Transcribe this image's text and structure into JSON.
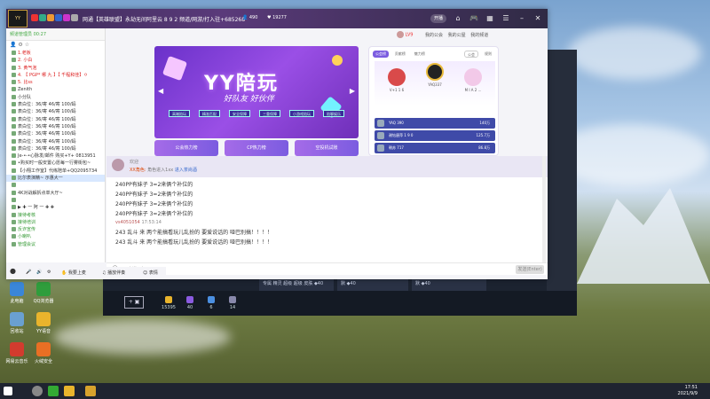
{
  "window": {
    "channel_logo": "YY",
    "title": "网通【英雄联盟】永劫无间阿里云 8 9 2 频道/网游/打入驻+685268",
    "member_count": "490",
    "fans": "19277",
    "open_btn": "开播",
    "level": "LV9",
    "right_links": [
      "我的公会",
      "我的公屋",
      "我的频道"
    ]
  },
  "sidebar": {
    "header": "频道管理员 00:27",
    "members": [
      {
        "text": "1.老板",
        "style": "red"
      },
      {
        "text": "2. 小白",
        "style": "red"
      },
      {
        "text": "3. 黄气泡",
        "style": "red"
      },
      {
        "text": "4. 【 PGP* 哪 九 】【 千程和佳】ㅇ",
        "style": "red"
      },
      {
        "text": "5. 比ss",
        "style": "red"
      },
      {
        "text": "Zenith",
        "style": "normal"
      },
      {
        "text": "小分队",
        "style": "normal"
      },
      {
        "text": "表白位：36/寄 46/寄 100/蚂",
        "style": "normal"
      },
      {
        "text": "表白位：36/寄 46/寄 100/蚂",
        "style": "normal"
      },
      {
        "text": "表白位：36/寄 46/寄 100/蚂",
        "style": "normal"
      },
      {
        "text": "表白位：36/寄 46/寄 100/蚂",
        "style": "normal"
      },
      {
        "text": "表白位：36/寄 46/寄 100/蚂",
        "style": "normal"
      },
      {
        "text": "表白位：36/寄 46/寄 100/蚂",
        "style": "normal"
      },
      {
        "text": "表白位：36/寄 46/寄 100/蚂",
        "style": "normal"
      },
      {
        "text": "Je-•-•心脉发/邮件 购买+Y+ 0813951",
        "style": "normal"
      },
      {
        "text": "•购买时一般安置心愿每一行雾街包~",
        "style": "normal"
      },
      {
        "text": "【小翔工作室】代练陪单+QQ2095734",
        "style": "normal"
      },
      {
        "text": "比尔表演精~ 示惠大一",
        "style": "hl"
      },
      {
        "text": "",
        "style": "normal"
      },
      {
        "text": "4K对战解拆点单大厅~",
        "style": "normal"
      },
      {
        "text": "",
        "style": "normal"
      },
      {
        "text": "▶ ✚ 一 阿 一 ✚ ✚",
        "style": "normal"
      },
      {
        "text": "接待考核",
        "style": "green"
      },
      {
        "text": "接待培训",
        "style": "green"
      },
      {
        "text": "反诈宣传",
        "style": "green"
      },
      {
        "text": "小喇叭",
        "style": "green"
      },
      {
        "text": "管理会议",
        "style": "green"
      }
    ]
  },
  "banner": {
    "title": "YY陪玩",
    "subtitle": "好队友 好伙伴",
    "tags": [
      "高端陪玩",
      "精准匹配",
      "安全保障",
      "三重保障",
      "小游戏陪玩",
      "陪聊娱乐"
    ],
    "features": [
      "公会热力榜",
      "CP热力榜",
      "空投机试账"
    ]
  },
  "rank": {
    "tabs": [
      "公会榜",
      "贡献榜",
      "魅力榜"
    ],
    "badge": "公会",
    "more": "规则",
    "podium": [
      {
        "name": "V+1 1 6",
        "label": "主播"
      },
      {
        "name": "YAQ337",
        "label": "公会长"
      },
      {
        "name": "M I A 2 ...",
        "label": "陪玩"
      }
    ],
    "rows": [
      {
        "name": "YAQ 390",
        "value": "140万"
      },
      {
        "name": "谢钻唐萍 1 9 0",
        "value": "125.7万"
      },
      {
        "name": "朝苏 717",
        "value": "86.8万"
      }
    ]
  },
  "chat": {
    "welcome_title": "欢迎",
    "welcome_role": "XX角色:",
    "welcome_text": "角色进入1xx",
    "welcome_link": "进入茶尚酒",
    "lines": [
      "240PP有妹子 3=2来俩个补位的",
      "240PP有妹子 3=2来俩个补位的",
      "240PP有妹子 3=2来俩个补位的",
      "240PP有妹子 3=2来俩个补位的"
    ],
    "meta_nick": "vs4051054",
    "meta_time": "17:53:14",
    "highlight_lines": [
      "243 乱斗 来 两个能搞看玩儿乱扮的 要爱说话的 哑巴别搞！！！！",
      "243 乱斗 来 两个能搞看玩儿乱扮的 要爱说话的 哑巴别搞！！！！"
    ]
  },
  "input": {
    "placeholder": "来说两句吧...",
    "send": "发送(Enter)"
  },
  "toolbar": {
    "items": [
      "我要上麦",
      "播放伴奏",
      "表情"
    ]
  },
  "game": {
    "cards": [
      "专属 精灵 超级 超级 皮肤",
      "默",
      "默"
    ],
    "card_values": [
      "40",
      "40",
      "40"
    ],
    "stats": [
      "15395",
      "40",
      "6",
      "14"
    ]
  },
  "desktop": {
    "icons": [
      "此电脑",
      "QQ浏览器",
      "回收站",
      "YY语音",
      "网易云音乐",
      "火绒安全"
    ]
  },
  "taskbar": {
    "time": "17:51",
    "date": "2021/9/9"
  }
}
